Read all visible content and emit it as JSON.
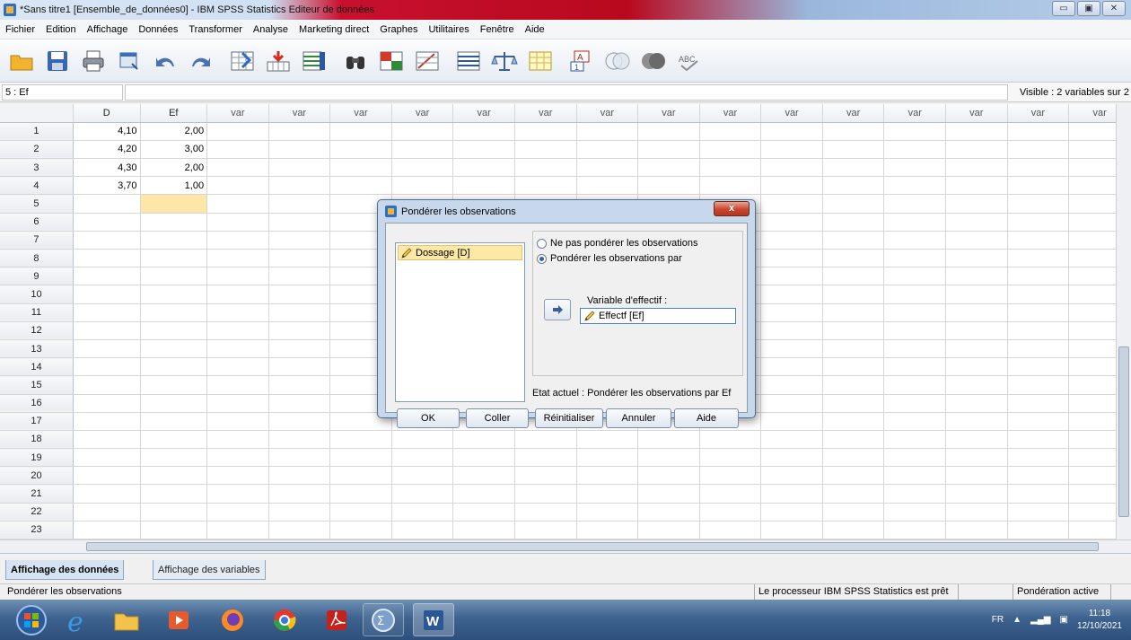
{
  "window": {
    "title": "*Sans titre1 [Ensemble_de_données0] - IBM SPSS Statistics Editeur de données",
    "controls": [
      "▭",
      "▣",
      "✕"
    ]
  },
  "menu": [
    "Fichier",
    "Edition",
    "Affichage",
    "Données",
    "Transformer",
    "Analyse",
    "Marketing direct",
    "Graphes",
    "Utilitaires",
    "Fenêtre",
    "Aide"
  ],
  "cellbar": {
    "cell_ref": "5 : Ef",
    "visible": "Visible : 2 variables sur 2"
  },
  "grid": {
    "columns": [
      "D",
      "Ef",
      "var",
      "var",
      "var",
      "var",
      "var",
      "var",
      "var",
      "var",
      "var",
      "var",
      "var",
      "var",
      "var",
      "var",
      "var"
    ],
    "row_numbers": [
      "1",
      "2",
      "3",
      "4",
      "5",
      "6",
      "7",
      "8",
      "9",
      "10",
      "11",
      "12",
      "13",
      "14",
      "15",
      "16",
      "17",
      "18",
      "19",
      "20",
      "21",
      "22",
      "23"
    ],
    "rows": [
      [
        "4,10",
        "2,00"
      ],
      [
        "4,20",
        "3,00"
      ],
      [
        "4,30",
        "2,00"
      ],
      [
        "3,70",
        "1,00"
      ]
    ]
  },
  "tabs": {
    "data_view": "Affichage des données",
    "variable_view": "Affichage des variables"
  },
  "status": {
    "left": "Pondérer les observations",
    "processor": "Le processeur IBM SPSS Statistics  est prêt",
    "weight": "Pondération active"
  },
  "dialog": {
    "title": "Pondérer les observations",
    "source_item": "Dossage [D]",
    "radio_no_weight": "Ne pas pondérer les observations",
    "radio_weight_by": "Pondérer les observations par",
    "freq_variable_label": "Variable d'effectif :",
    "freq_variable_value": "Effectf [Ef]",
    "current_status": "Etat actuel : Pondérer les observations par Ef",
    "buttons": {
      "ok": "OK",
      "paste": "Coller",
      "reset": "Réinitialiser",
      "cancel": "Annuler",
      "help": "Aide"
    }
  },
  "taskbar": {
    "lang": "FR",
    "time": "11:18",
    "date": "12/10/2021"
  }
}
